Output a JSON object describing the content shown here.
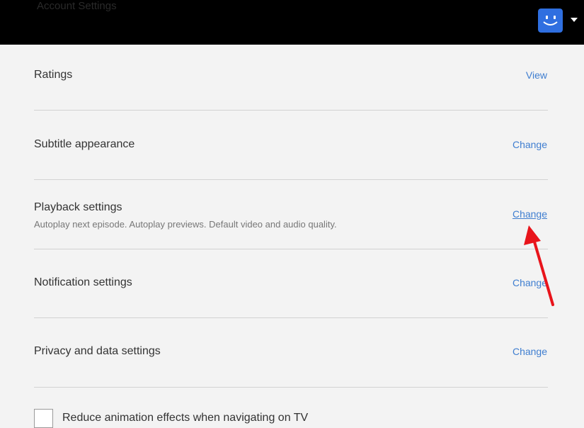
{
  "topbar": {
    "title": "Account Settings"
  },
  "settings": {
    "rows": [
      {
        "title": "Ratings",
        "subtitle": "",
        "action": "View"
      },
      {
        "title": "Subtitle appearance",
        "subtitle": "",
        "action": "Change"
      },
      {
        "title": "Playback settings",
        "subtitle": "Autoplay next episode. Autoplay previews. Default video and audio quality.",
        "action": "Change"
      },
      {
        "title": "Notification settings",
        "subtitle": "",
        "action": "Change"
      },
      {
        "title": "Privacy and data settings",
        "subtitle": "",
        "action": "Change"
      }
    ]
  },
  "checkbox": {
    "label": "Reduce animation effects when navigating on TV"
  },
  "colors": {
    "topbar": "#000000",
    "background": "#f3f3f3",
    "link": "#3f7ed0",
    "avatar": "#2f6fe0",
    "annotation_arrow": "#e8141b"
  },
  "icons": {
    "avatar": "smiley-profile-icon",
    "menu": "caret-down-icon",
    "annotation": "red-arrow-annotation"
  }
}
